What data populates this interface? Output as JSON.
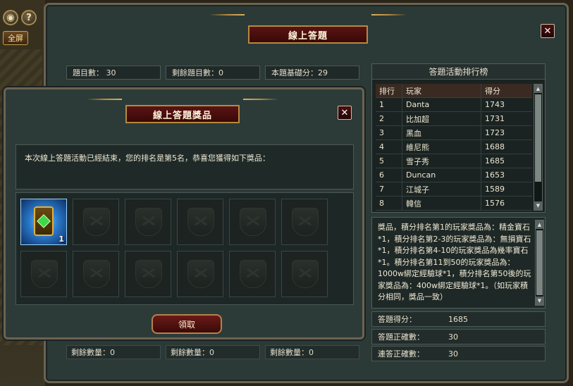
{
  "hud": {
    "fullscreen_label": "全屏",
    "help_glyph": "?"
  },
  "main_window": {
    "title": "線上答題",
    "close_glyph": "✕",
    "stats": {
      "question_count": "題目數：  30",
      "remaining_questions": "剩餘題目數：0",
      "base_score": "本題基礎分：29"
    },
    "ranking": {
      "title": "答題活動排行榜",
      "headers": [
        "排行",
        "玩家",
        "得分"
      ],
      "rows": [
        {
          "rank": "1",
          "player": "Danta",
          "score": "1743"
        },
        {
          "rank": "2",
          "player": "比加超",
          "score": "1731"
        },
        {
          "rank": "3",
          "player": "黑血",
          "score": "1723"
        },
        {
          "rank": "4",
          "player": "維尼熊",
          "score": "1688"
        },
        {
          "rank": "5",
          "player": "雪子秀",
          "score": "1685"
        },
        {
          "rank": "6",
          "player": "Duncan",
          "score": "1653"
        },
        {
          "rank": "7",
          "player": "江城子",
          "score": "1589"
        },
        {
          "rank": "8",
          "player": "韓信",
          "score": "1576"
        }
      ]
    },
    "reward_description": "獎品，積分排名第1的玩家獎品為：精金寶石*1，積分排名第2-3的玩家獎品為：無損寶石*1，積分排名第4-10的玩家獎品為幾率寶石*1。積分排名第11到50的玩家獎品為：1000w綁定經驗球*1，積分排名第50後的玩家獎品為：400w綁定經驗球*1。（如玩家積分相同，獎品一致）",
    "score": {
      "label": "答題得分：",
      "value": "1685"
    },
    "correct": {
      "label": "答題正確數：",
      "value": "30"
    },
    "streak": {
      "label": "連答正確數：",
      "value": "30"
    },
    "bottom_stats": [
      "剩餘數量：0",
      "剩餘數量：0",
      "剩餘數量：0"
    ]
  },
  "popup": {
    "title": "線上答題獎品",
    "close_glyph": "✕",
    "message": "本次線上答題活動已經結束，您的排名是第5名，恭喜您獲得如下獎品：",
    "item_quantity": "1",
    "claim_label": "領取"
  },
  "colors": {
    "accent_gold": "#b58a3e",
    "title_red": "#5a1414",
    "panel_bg": "#2c3a37"
  }
}
